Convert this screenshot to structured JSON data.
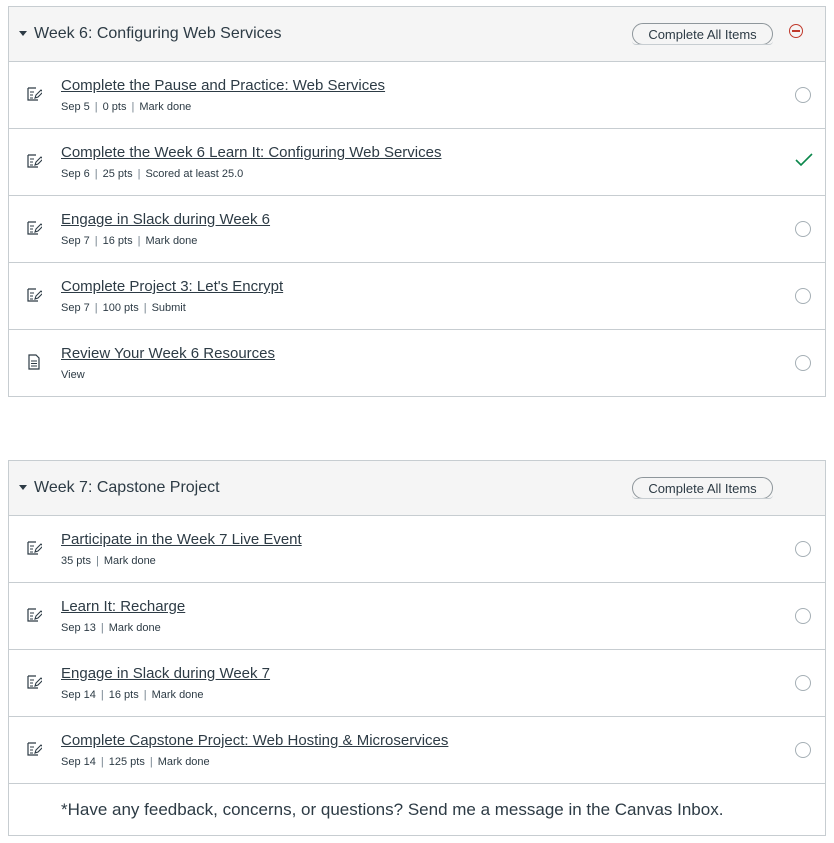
{
  "modules": [
    {
      "title": "Week 6: Configuring Web Services",
      "complete_all_label": "Complete All Items",
      "status_icon": "minus-circle-icon",
      "items": [
        {
          "title": "Complete the Pause and Practice: Web Services",
          "date": "Sep 5",
          "points": "0 pts",
          "action": "Mark done",
          "done": false
        },
        {
          "title": "Complete the Week 6 Learn It: Configuring Web Services",
          "date": "Sep 6",
          "points": "25 pts",
          "action": "Scored at least 25.0",
          "done": true
        },
        {
          "title": "Engage in Slack during Week 6",
          "date": "Sep 7",
          "points": "16 pts",
          "action": "Mark done",
          "done": false
        },
        {
          "title": "Complete Project 3: Let's Encrypt",
          "date": "Sep 7",
          "points": "100 pts",
          "action": "Submit",
          "done": false
        },
        {
          "title": "Review Your Week 6 Resources",
          "action": "View",
          "done": false,
          "type": "page"
        }
      ]
    },
    {
      "title": "Week 7: Capstone Project",
      "complete_all_label": "Complete All Items",
      "items": [
        {
          "title": "Participate in the Week 7 Live Event",
          "points": "35 pts",
          "action": "Mark done",
          "done": false
        },
        {
          "title": "Learn It: Recharge",
          "date": "Sep 13",
          "action": "Mark done",
          "done": false
        },
        {
          "title": "Engage in Slack during Week 7",
          "date": "Sep 14",
          "points": "16 pts",
          "action": "Mark done",
          "done": false
        },
        {
          "title": "Complete Capstone Project: Web Hosting & Microservices",
          "date": "Sep 14",
          "points": "125 pts",
          "action": "Mark done",
          "done": false
        }
      ],
      "footer_text": "*Have any feedback, concerns, or questions? Send me a message in the Canvas Inbox."
    }
  ],
  "colors": {
    "text": "#2d3b45",
    "header_bg": "#f5f5f5",
    "border": "#c7cdd1",
    "check": "#0b874b",
    "incomplete_icon": "#c0392b"
  }
}
